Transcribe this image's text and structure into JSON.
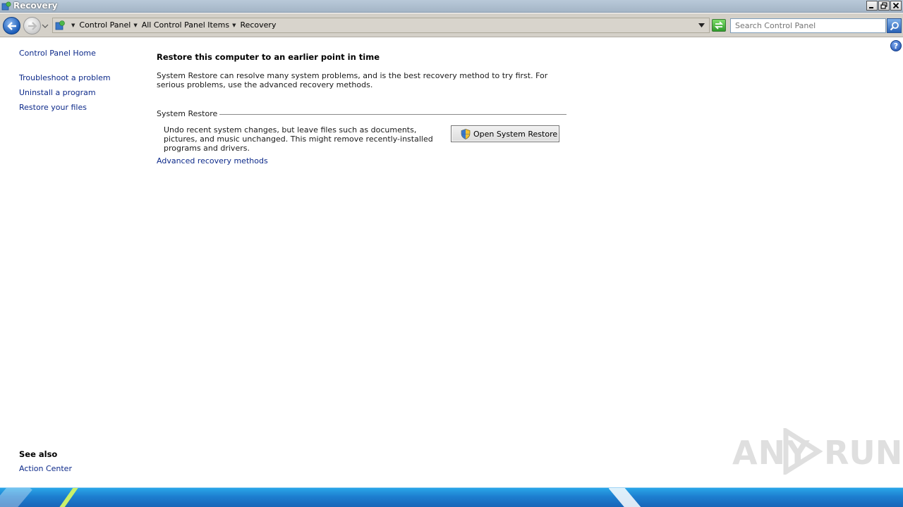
{
  "window": {
    "title": "Recovery",
    "controls": {
      "minimize": "minimize-icon",
      "restore": "restore-icon",
      "close": "close-icon"
    }
  },
  "address_bar": {
    "breadcrumbs": [
      "Control Panel",
      "All Control Panel Items",
      "Recovery"
    ],
    "search_placeholder": "Search Control Panel"
  },
  "sidebar": {
    "home_link": "Control Panel Home",
    "links": [
      "Troubleshoot a problem",
      "Uninstall a program",
      "Restore your files"
    ],
    "see_also_heading": "See also",
    "see_also_links": [
      "Action Center"
    ]
  },
  "main": {
    "title": "Restore this computer to an earlier point in time",
    "description": "System Restore can resolve many system problems, and is the best recovery method to try first. For serious problems, use the advanced recovery methods.",
    "section": {
      "heading": "System Restore",
      "description": "Undo recent system changes, but leave files such as documents, pictures, and music unchanged. This might remove recently-installed programs and drivers.",
      "button_label": "Open System Restore"
    },
    "advanced_link": "Advanced recovery methods"
  },
  "watermark": {
    "left": "ANY",
    "right": "RUN"
  },
  "colors": {
    "link": "#0d2a8a",
    "taskbar": "#1d7fd0"
  }
}
